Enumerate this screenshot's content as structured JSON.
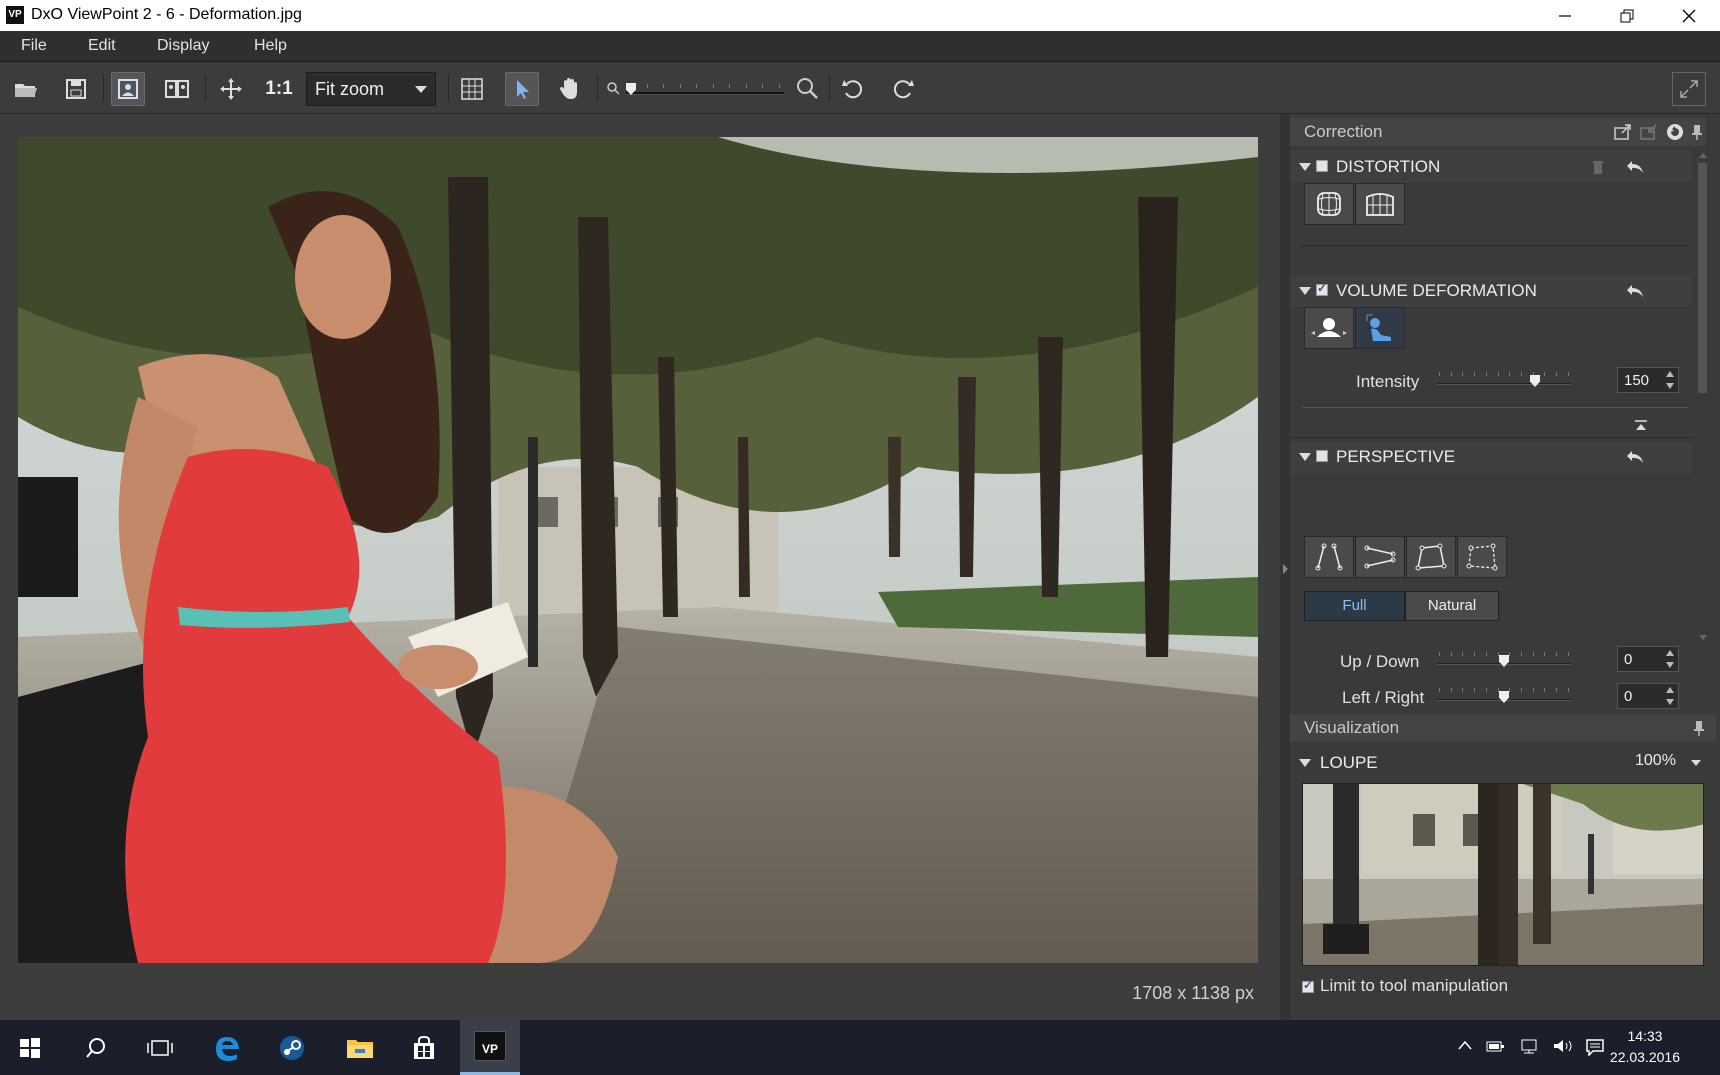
{
  "window": {
    "app_icon": "VP",
    "title": "DxO ViewPoint 2 - 6 - Deformation.jpg",
    "controls": [
      "minimize-icon",
      "restore-icon",
      "close-icon"
    ]
  },
  "menu": {
    "file": "File",
    "edit": "Edit",
    "display": "Display",
    "help": "Help"
  },
  "toolbar": {
    "one_to_one": "1:1",
    "zoom_value": "Fit zoom",
    "zoom_slider_position": 0.0
  },
  "image": {
    "size_label": "1708 x 1138 px"
  },
  "correction_panel": {
    "title": "Correction",
    "distortion": {
      "label": "DISTORTION",
      "enabled": false
    },
    "volume_deformation": {
      "label": "VOLUME DEFORMATION",
      "enabled": true,
      "intensity_label": "Intensity",
      "intensity_value": "150",
      "intensity_fraction": 0.75
    },
    "perspective": {
      "label": "PERSPECTIVE",
      "enabled": false,
      "mode_full": "Full",
      "mode_natural": "Natural",
      "up_down_label": "Up / Down",
      "up_down_value": "0",
      "left_right_label": "Left / Right",
      "left_right_value": "0"
    }
  },
  "visualization_panel": {
    "title": "Visualization",
    "loupe_label": "LOUPE",
    "loupe_zoom": "100%",
    "limit_label": "Limit to tool manipulation",
    "limit_checked": true
  },
  "taskbar": {
    "time": "14:33",
    "date": "22.03.2016",
    "active_app": "VP"
  },
  "colors": {
    "accent": "#5aa0e6",
    "dress": "#e23b3e",
    "taskbar": "#1b1f2b"
  }
}
